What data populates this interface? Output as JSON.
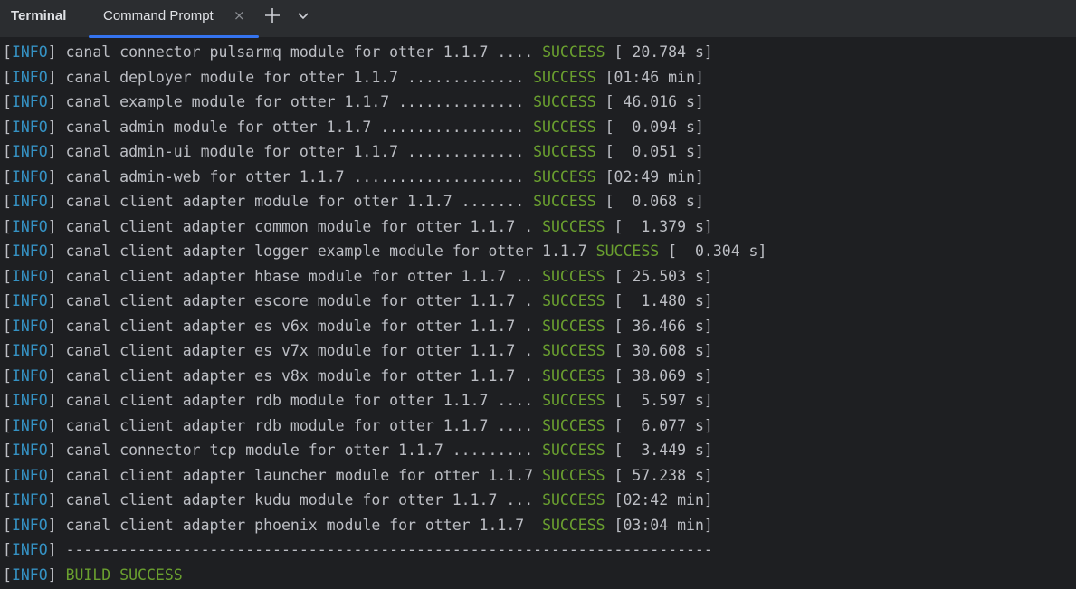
{
  "app": {
    "title": "Terminal"
  },
  "tabs": [
    {
      "label": "Command Prompt",
      "active": true,
      "close_glyph": "×"
    }
  ],
  "toolbar": {
    "new_tab_icon": "plus-icon",
    "dropdown_icon": "chevron-down-icon"
  },
  "colors": {
    "background": "#1e1f22",
    "tabbar": "#2b2d30",
    "info_tag": "#3592c4",
    "success": "#6a9f2f",
    "text": "#bcbec4",
    "active_tab_underline": "#3574f0"
  },
  "terminal": {
    "lines": [
      {
        "tag": "INFO",
        "text": "canal connector pulsarmq module for otter 1.1.7 .... ",
        "status": "SUCCESS",
        "suffix": " [ 20.784 s]"
      },
      {
        "tag": "INFO",
        "text": "canal deployer module for otter 1.1.7 ............. ",
        "status": "SUCCESS",
        "suffix": " [01:46 min]"
      },
      {
        "tag": "INFO",
        "text": "canal example module for otter 1.1.7 .............. ",
        "status": "SUCCESS",
        "suffix": " [ 46.016 s]"
      },
      {
        "tag": "INFO",
        "text": "canal admin module for otter 1.1.7 ................ ",
        "status": "SUCCESS",
        "suffix": " [  0.094 s]"
      },
      {
        "tag": "INFO",
        "text": "canal admin-ui module for otter 1.1.7 ............. ",
        "status": "SUCCESS",
        "suffix": " [  0.051 s]"
      },
      {
        "tag": "INFO",
        "text": "canal admin-web for otter 1.1.7 ................... ",
        "status": "SUCCESS",
        "suffix": " [02:49 min]"
      },
      {
        "tag": "INFO",
        "text": "canal client adapter module for otter 1.1.7 ....... ",
        "status": "SUCCESS",
        "suffix": " [  0.068 s]"
      },
      {
        "tag": "INFO",
        "text": "canal client adapter common module for otter 1.1.7 . ",
        "status": "SUCCESS",
        "suffix": " [  1.379 s]"
      },
      {
        "tag": "INFO",
        "text": "canal client adapter logger example module for otter 1.1.7 ",
        "status": "SUCCESS",
        "suffix": " [  0.304 s]"
      },
      {
        "tag": "INFO",
        "text": "canal client adapter hbase module for otter 1.1.7 .. ",
        "status": "SUCCESS",
        "suffix": " [ 25.503 s]"
      },
      {
        "tag": "INFO",
        "text": "canal client adapter escore module for otter 1.1.7 . ",
        "status": "SUCCESS",
        "suffix": " [  1.480 s]"
      },
      {
        "tag": "INFO",
        "text": "canal client adapter es v6x module for otter 1.1.7 . ",
        "status": "SUCCESS",
        "suffix": " [ 36.466 s]"
      },
      {
        "tag": "INFO",
        "text": "canal client adapter es v7x module for otter 1.1.7 . ",
        "status": "SUCCESS",
        "suffix": " [ 30.608 s]"
      },
      {
        "tag": "INFO",
        "text": "canal client adapter es v8x module for otter 1.1.7 . ",
        "status": "SUCCESS",
        "suffix": " [ 38.069 s]"
      },
      {
        "tag": "INFO",
        "text": "canal client adapter rdb module for otter 1.1.7 .... ",
        "status": "SUCCESS",
        "suffix": " [  5.597 s]"
      },
      {
        "tag": "INFO",
        "text": "canal client adapter rdb module for otter 1.1.7 .... ",
        "status": "SUCCESS",
        "suffix": " [  6.077 s]"
      },
      {
        "tag": "INFO",
        "text": "canal connector tcp module for otter 1.1.7 ......... ",
        "status": "SUCCESS",
        "suffix": " [  3.449 s]"
      },
      {
        "tag": "INFO",
        "text": "canal client adapter launcher module for otter 1.1.7 ",
        "status": "SUCCESS",
        "suffix": " [ 57.238 s]"
      },
      {
        "tag": "INFO",
        "text": "canal client adapter kudu module for otter 1.1.7 ... ",
        "status": "SUCCESS",
        "suffix": " [02:42 min]"
      },
      {
        "tag": "INFO",
        "text": "canal client adapter phoenix module for otter 1.1.7  ",
        "status": "SUCCESS",
        "suffix": " [03:04 min]"
      },
      {
        "tag": "INFO",
        "text": "------------------------------------------------------------------------",
        "status": "",
        "suffix": ""
      },
      {
        "tag": "INFO",
        "text": "",
        "status": "BUILD SUCCESS",
        "suffix": ""
      }
    ]
  }
}
